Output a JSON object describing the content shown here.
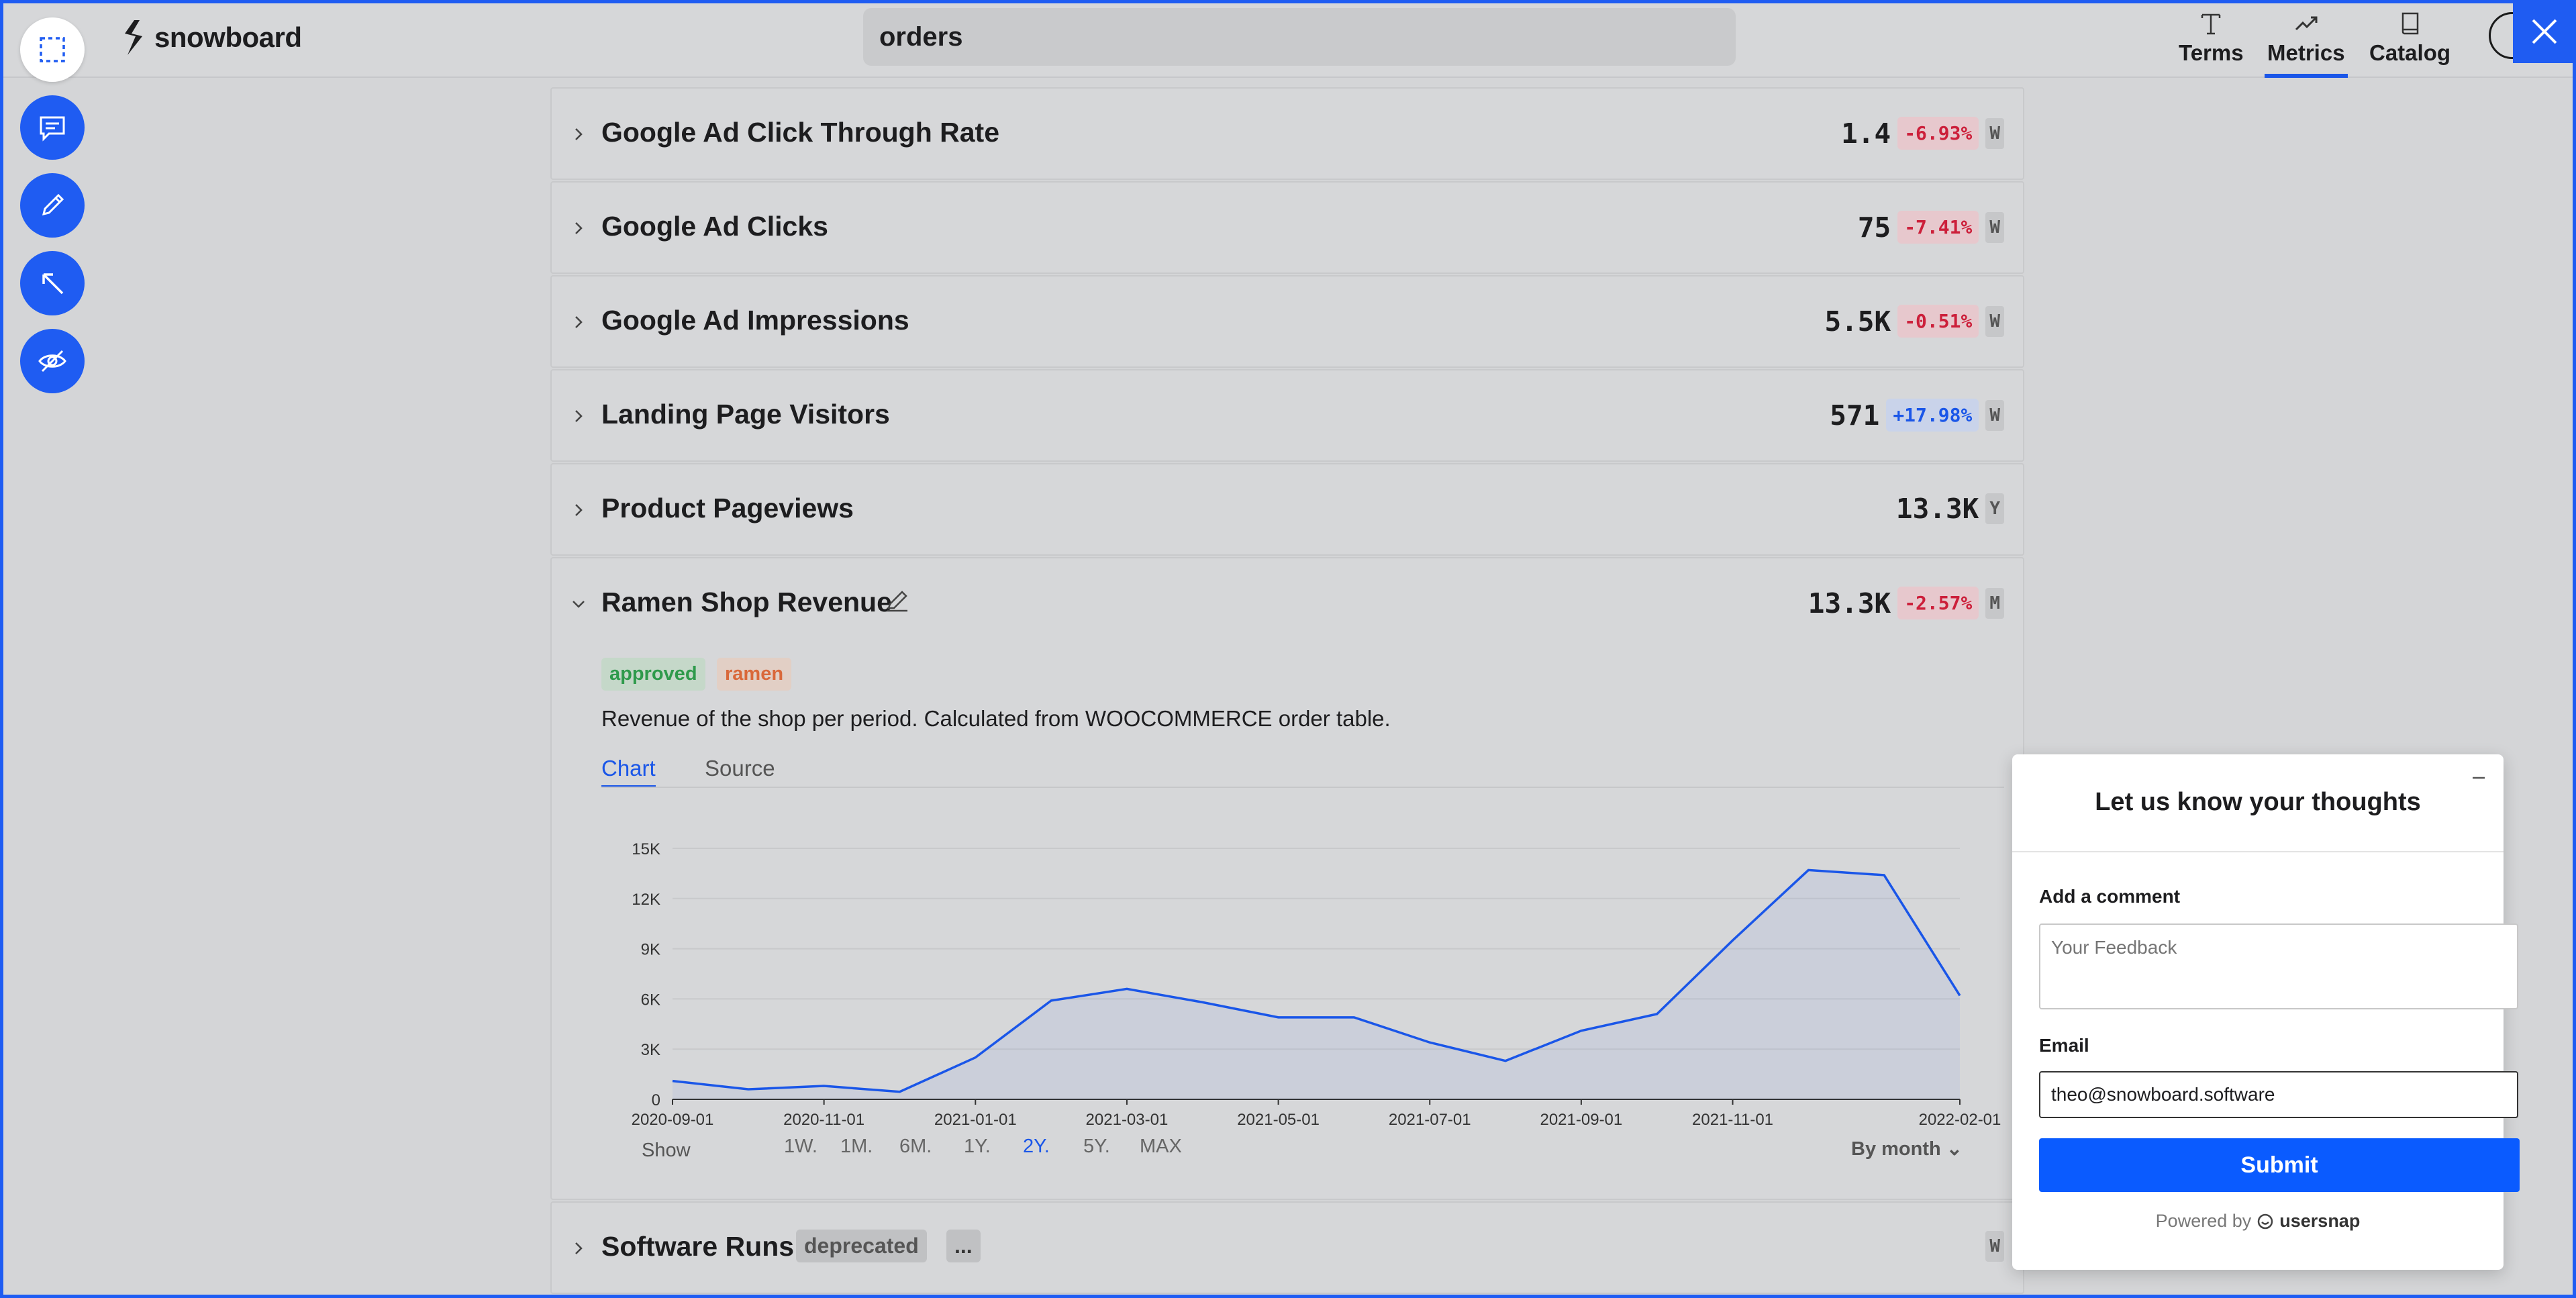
{
  "app": {
    "logo_text": "snowboard"
  },
  "search": {
    "value": "orders"
  },
  "nav": [
    {
      "label": "Terms",
      "icon": "text-icon",
      "active": false
    },
    {
      "label": "Metrics",
      "icon": "trend-icon",
      "active": true
    },
    {
      "label": "Catalog",
      "icon": "book-icon",
      "active": false
    }
  ],
  "tools": [
    "select-area-icon",
    "comment-icon",
    "pen-icon",
    "arrow-icon",
    "hide-icon"
  ],
  "metrics": [
    {
      "name": "Google Ad Click Through Rate",
      "value": "1.4",
      "change": "-6.93%",
      "direction": "neg",
      "period": "W"
    },
    {
      "name": "Google Ad Clicks",
      "value": "75",
      "change": "-7.41%",
      "direction": "neg",
      "period": "W"
    },
    {
      "name": "Google Ad Impressions",
      "value": "5.5K",
      "change": "-0.51%",
      "direction": "neg",
      "period": "W"
    },
    {
      "name": "Landing Page Visitors",
      "value": "571",
      "change": "+17.98%",
      "direction": "pos",
      "period": "W"
    },
    {
      "name": "Product Pageviews",
      "value": "13.3K",
      "change": "",
      "direction": "none",
      "period": "Y"
    }
  ],
  "expanded": {
    "name": "Ramen Shop Revenue",
    "value": "13.3K",
    "change": "-2.57%",
    "period": "M",
    "tags": [
      {
        "label": "approved",
        "color": "#2e9a4b",
        "bg": "#c5d8c9"
      },
      {
        "label": "ramen",
        "color": "#d9683a",
        "bg": "#e2cfc5"
      }
    ],
    "description": "Revenue of the shop per period. Calculated from WOOCOMMERCE order table.",
    "tabs": {
      "chart": "Chart",
      "source": "Source"
    },
    "show_label": "Show",
    "ranges": [
      "1W.",
      "1M.",
      "6M.",
      "1Y.",
      "2Y.",
      "5Y.",
      "MAX"
    ],
    "active_range": "2Y.",
    "granularity": "By month"
  },
  "chart_data": {
    "type": "area",
    "x": [
      "2020-09-01",
      "2020-10-01",
      "2020-11-01",
      "2020-12-01",
      "2021-01-01",
      "2021-02-01",
      "2021-03-01",
      "2021-04-01",
      "2021-05-01",
      "2021-06-01",
      "2021-07-01",
      "2021-08-01",
      "2021-09-01",
      "2021-10-01",
      "2021-11-01",
      "2021-12-01",
      "2022-01-01",
      "2022-02-01"
    ],
    "values": [
      1100,
      600,
      800,
      450,
      2500,
      5900,
      6600,
      5800,
      4900,
      4900,
      3400,
      2300,
      4100,
      5100,
      9500,
      13700,
      13400,
      6200
    ],
    "x_ticks": [
      "2020-09-01",
      "2020-11-01",
      "2021-01-01",
      "2021-03-01",
      "2021-05-01",
      "2021-07-01",
      "2021-09-01",
      "2021-11-01",
      "2022-02-01"
    ],
    "y_ticks": [
      "0",
      "3K",
      "6K",
      "9K",
      "12K",
      "15K"
    ],
    "ylim": [
      0,
      15000
    ],
    "color": "#1a56e8",
    "grid": true
  },
  "software_runs": {
    "name": "Software Runs",
    "badge": "deprecated",
    "more": "...",
    "period": "W"
  },
  "feedback": {
    "title": "Let us know your thoughts",
    "comment_label": "Add a comment",
    "comment_placeholder": "Your Feedback",
    "email_label": "Email",
    "email_value": "theo@snowboard.software",
    "submit": "Submit",
    "powered_by": "Powered by",
    "brand": "usersnap"
  }
}
